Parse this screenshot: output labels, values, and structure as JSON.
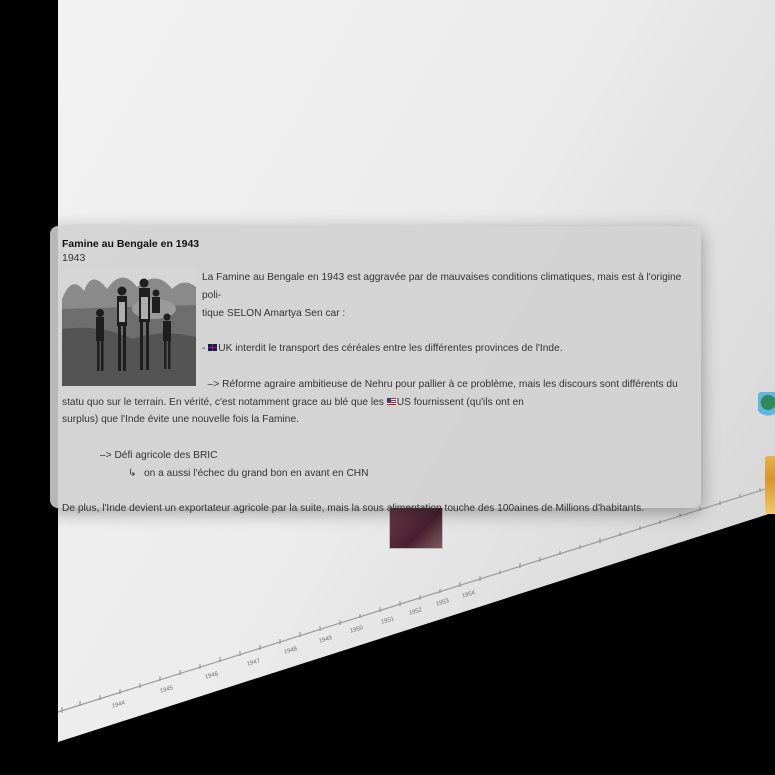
{
  "card": {
    "title": "Famine au Bengale en 1943",
    "date": "1943",
    "line1": "La Famine au Bengale en 1943 est aggravée par de mauvaises conditions climatiques, mais est à l'origine poli-",
    "line2": "tique SELON Amartya Sen car :",
    "bullet_prefix": "- ",
    "bullet_text": "UK  interdit le transport des céréales entre les différentes provinces de l'Inde.",
    "reform_line1": "  –> Réforme agraire ambitieuse de Nehru pour pallier à ce problème, mais les discours sont différents du",
    "reform_line2a": "statu quo sur le terrain. En vérité, c'est notamment grace au blé que les ",
    "reform_line2b": "US fournissent (qu'ils ont en",
    "reform_line3": "surplus) que l'Inde évite une nouvelle fois la Famine.",
    "bric_line": "–> Défi agricole des BRIC",
    "sub_arrow": "↳",
    "chn_line": "on a aussi l'échec du grand bon en avant en CHN",
    "final_line": "De plus, l'Inde devient un exportateur agricole par la suite, mais la sous alimentation touche des 100aines de Millions d'habitants."
  },
  "timeline": {
    "visible_ticks": [
      "1944",
      "1945",
      "1946",
      "1947",
      "1948",
      "1949",
      "1950",
      "1951",
      "1952",
      "1953",
      "1954"
    ]
  },
  "icons": {
    "uk_flag": "uk-flag-icon",
    "us_flag": "us-flag-icon"
  }
}
